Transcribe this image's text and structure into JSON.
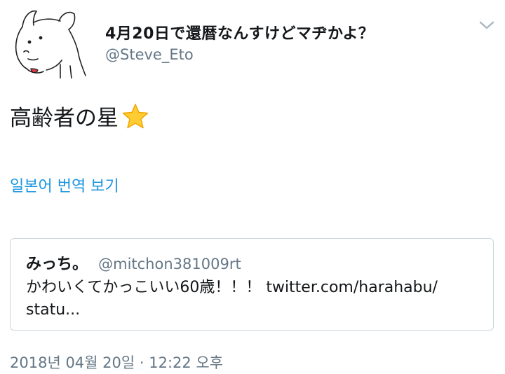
{
  "tweet": {
    "author": {
      "display_name": "4月20日で還暦なんすけどマヂかよ？",
      "username": "@Steve_Eto",
      "avatar_icon": "dog-drawing-avatar"
    },
    "menu_icon": "chevron-down-icon",
    "text": "高齢者の星",
    "emoji": "star-icon",
    "translate_label": "일본어 번역 보기",
    "quoted": {
      "display_name": "みっち。",
      "username": "@mitchon381009rt",
      "text_line1": "かわいくてかっこいい60歳！！！ twitter.com/harahabu/",
      "text_line2": "statu..."
    },
    "timestamp": "2018년 04월 20일 · 12:22 오후"
  },
  "colors": {
    "text": "#14171a",
    "secondary": "#657786",
    "link": "#1b95e0",
    "border": "#ccd6dd",
    "star": "#ffcc33"
  }
}
